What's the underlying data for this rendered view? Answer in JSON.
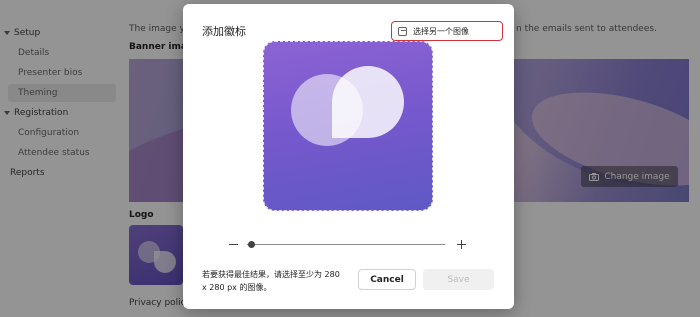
{
  "sidebar": {
    "items": [
      {
        "label": "Setup",
        "expandable": true
      },
      {
        "label": "Details"
      },
      {
        "label": "Presenter bios"
      },
      {
        "label": "Theming",
        "selected": true
      },
      {
        "label": "Registration",
        "expandable": true
      },
      {
        "label": "Configuration"
      },
      {
        "label": "Attendee status"
      },
      {
        "label": "Reports"
      }
    ]
  },
  "main": {
    "description_left": "The image yo",
    "description_right": "n the emails sent to attendees.",
    "banner_label": "Banner image",
    "change_image_label": "Change image",
    "logo_label": "Logo",
    "privacy_label": "Privacy policy"
  },
  "dialog": {
    "title": "添加徽标",
    "choose_other_label": "选择另一个图像",
    "zoom_level": 0.02,
    "hint": "若要获得最佳结果，请选择至少为 280 x 280 px 的图像。",
    "cancel_label": "Cancel",
    "save_label": "Save"
  },
  "colors": {
    "accent_red": "#d13438",
    "logo_purple": "#7558cd"
  }
}
